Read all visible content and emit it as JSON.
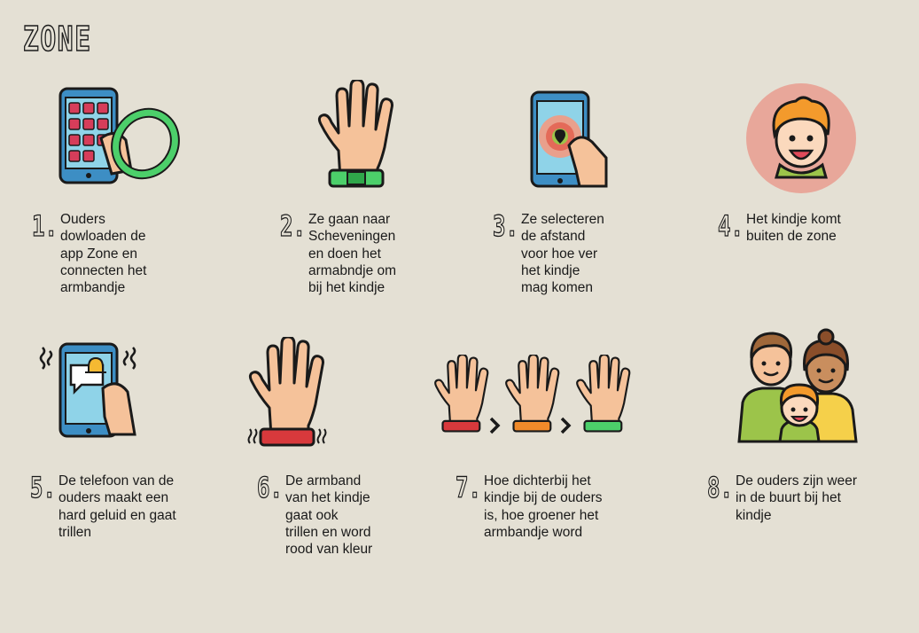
{
  "title": "ZONE",
  "steps": [
    {
      "number": "1.",
      "text": "Ouders\ndowloaden de\napp Zone en\nconnecten het\narmbandje"
    },
    {
      "number": "2.",
      "text": "Ze gaan naar\nScheveningen\nen doen het\narmabndje om\nbij het kindje"
    },
    {
      "number": "3.",
      "text": "Ze selecteren\nde afstand\nvoor hoe ver\nhet kindje\nmag komen"
    },
    {
      "number": "4.",
      "text": "Het kindje komt\nbuiten de zone"
    },
    {
      "number": "5.",
      "text": "De telefoon van de\nouders maakt een\nhard geluid en gaat\ntrillen"
    },
    {
      "number": "6.",
      "text": "De armband\nvan het kindje\ngaat ook\ntrillen en word\nrood van kleur"
    },
    {
      "number": "7.",
      "text": "Hoe dichterbij het\nkindje bij de ouders\nis, hoe groener het\narmbandje word"
    },
    {
      "number": "8.",
      "text": "De ouders zijn weer\nin de buurt bij het\nkindje"
    }
  ],
  "icons": [
    "phone-with-bracelet-icon",
    "hand-with-green-bracelet-icon",
    "phone-location-icon",
    "child-face-icon",
    "phone-notification-icon",
    "hand-with-red-bracelet-icon",
    "hands-color-progression-icon",
    "family-icon"
  ],
  "colors": {
    "background": "#e4e0d4",
    "skin": "#f5c29a",
    "phone": "#3d8ec4",
    "screen": "#8fd3e8",
    "app_tile": "#d63d5a",
    "green_band": "#4ccf6a",
    "red_band": "#d8393c",
    "orange_band": "#f08a2a",
    "hair_orange": "#f39a2c",
    "child_circle": "#e8a79a",
    "outline": "#1a1a1a"
  }
}
